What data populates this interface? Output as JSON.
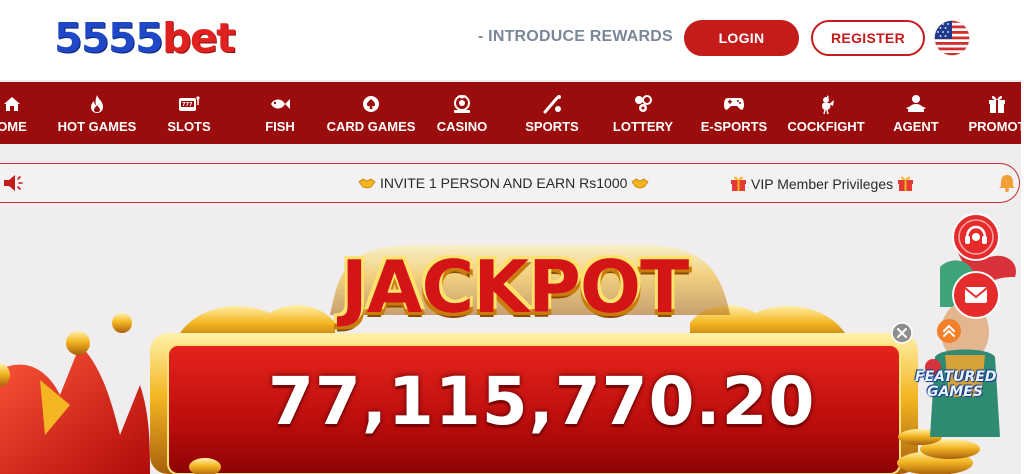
{
  "header": {
    "logo_num": "5555",
    "logo_text": "bet",
    "intro_link": "- INTRODUCE REWARDS",
    "login_label": "LOGIN",
    "register_label": "REGISTER",
    "language_icon": "us-flag-icon"
  },
  "nav": {
    "items": [
      {
        "label": "OME",
        "icon": "home-icon"
      },
      {
        "label": "HOT GAMES",
        "icon": "flame-icon"
      },
      {
        "label": "SLOTS",
        "icon": "slot-machine-icon"
      },
      {
        "label": "FISH",
        "icon": "fish-icon"
      },
      {
        "label": "CARD GAMES",
        "icon": "cards-icon"
      },
      {
        "label": "CASINO",
        "icon": "casino-icon"
      },
      {
        "label": "SPORTS",
        "icon": "sports-icon"
      },
      {
        "label": "LOTTERY",
        "icon": "lottery-icon"
      },
      {
        "label": "E-SPORTS",
        "icon": "gamepad-icon"
      },
      {
        "label": "COCKFIGHT",
        "icon": "cockfight-icon"
      },
      {
        "label": "AGENT",
        "icon": "agent-icon"
      },
      {
        "label": "PROMOT",
        "icon": "gift-icon"
      }
    ]
  },
  "marquee": {
    "messages": [
      "INVITE 1 PERSON AND EARN Rs1000",
      "VIP Member Privileges"
    ]
  },
  "jackpot": {
    "title": "JACKPOT",
    "amount": "77,115,770.20"
  },
  "featured": {
    "label_line1": "FEATURED",
    "label_line2": "GAMES"
  },
  "colors": {
    "brand_red": "#c41b1b",
    "nav_bg": "#9b0c0c",
    "logo_blue": "#1f47c6",
    "logo_red": "#e0211f"
  }
}
